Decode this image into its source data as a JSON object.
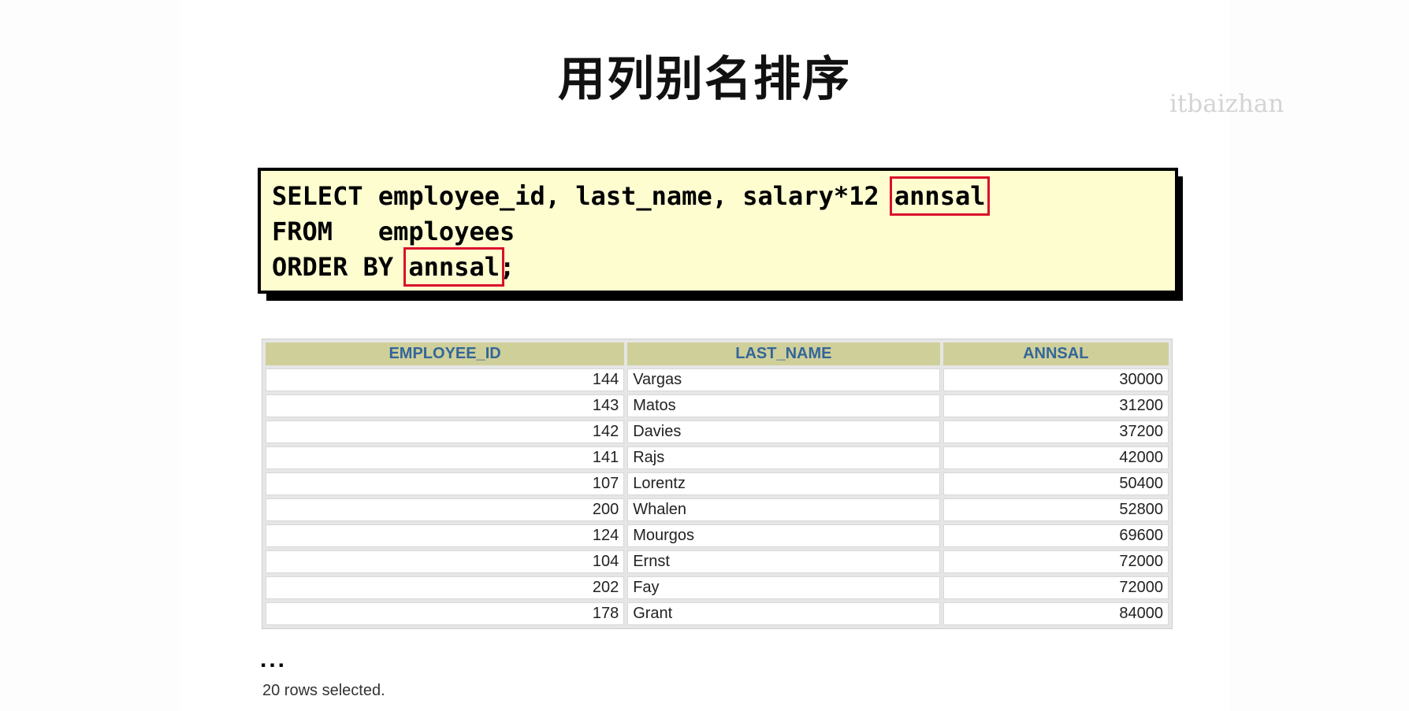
{
  "slide": {
    "title": "用列别名排序",
    "watermark": "itbaizhan"
  },
  "code": {
    "line1_prefix": "SELECT employee_id, last_name, salary*12 ",
    "line1_alias": "annsal",
    "line2": "FROM   employees",
    "line3_prefix": "ORDER BY ",
    "line3_alias": "annsal",
    "line3_suffix": ";",
    "highlight_color": "#d9102a",
    "box_background": "#fefdd0"
  },
  "table": {
    "columns": [
      "EMPLOYEE_ID",
      "LAST_NAME",
      "ANNSAL"
    ],
    "rows": [
      [
        "144",
        "Vargas",
        "30000"
      ],
      [
        "143",
        "Matos",
        "31200"
      ],
      [
        "142",
        "Davies",
        "37200"
      ],
      [
        "141",
        "Rajs",
        "42000"
      ],
      [
        "107",
        "Lorentz",
        "50400"
      ],
      [
        "200",
        "Whalen",
        "52800"
      ],
      [
        "124",
        "Mourgos",
        "69600"
      ],
      [
        "104",
        "Ernst",
        "72000"
      ],
      [
        "202",
        "Fay",
        "72000"
      ],
      [
        "178",
        "Grant",
        "84000"
      ]
    ],
    "header_background": "#cfcf9a",
    "header_text_color": "#336699"
  },
  "ellipsis": "...",
  "footer": "20 rows selected."
}
